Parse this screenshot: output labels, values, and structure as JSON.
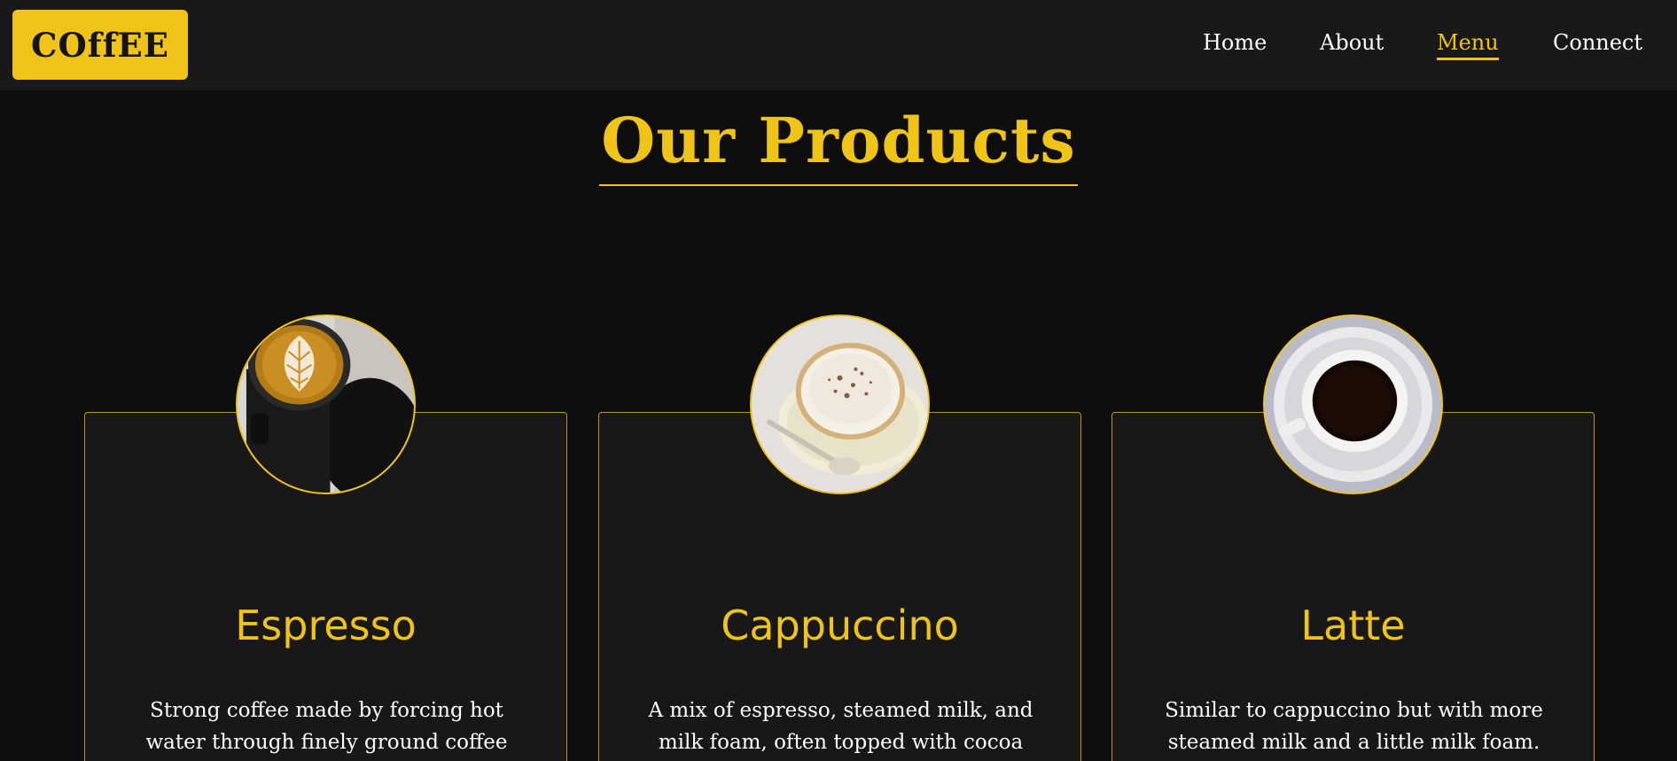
{
  "header": {
    "logo": "COffEE",
    "nav": [
      {
        "label": "Home",
        "active": false
      },
      {
        "label": "About",
        "active": false
      },
      {
        "label": "Menu",
        "active": true
      },
      {
        "label": "Connect",
        "active": false
      }
    ]
  },
  "section": {
    "title": "Our Products"
  },
  "products": [
    {
      "name": "Espresso",
      "description": "Strong coffee made by forcing hot water through finely ground coffee beans.",
      "image_icon": "latte-art-cup-photo"
    },
    {
      "name": "Cappuccino",
      "description": "A mix of espresso, steamed milk, and milk foam, often topped with cocoa powder.",
      "image_icon": "cappuccino-cup-photo"
    },
    {
      "name": "Latte",
      "description": "Similar to cappuccino but with more steamed milk and a little milk foam.",
      "image_icon": "black-coffee-cup-photo"
    }
  ],
  "colors": {
    "accent": "#f0c417",
    "header_bg": "#191919",
    "page_bg": "#0e0e0e",
    "card_bg": "#181818"
  }
}
